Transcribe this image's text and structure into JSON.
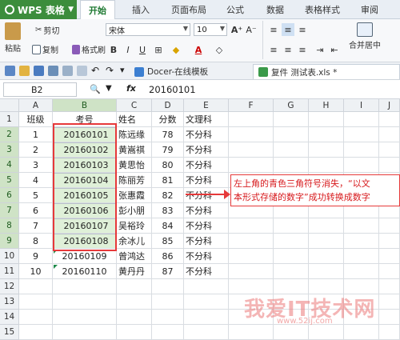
{
  "app": {
    "name": "WPS 表格"
  },
  "ribbon_tabs": [
    "开始",
    "插入",
    "页面布局",
    "公式",
    "数据",
    "表格样式",
    "审阅"
  ],
  "ribbon": {
    "paste": "粘贴",
    "cut": "剪切",
    "copy": "复制",
    "format_painter": "格式刷",
    "font": "宋体",
    "font_size": "10",
    "merge_center": "合并居中"
  },
  "doc_tabs": [
    {
      "label": "Docer-在线模板",
      "icon": "docer-icon"
    },
    {
      "label": "复件 测试表.xls *",
      "icon": "spreadsheet-icon"
    }
  ],
  "formula_bar": {
    "cell_ref": "B2",
    "fx": "fx",
    "value": "20160101"
  },
  "columns": [
    "A",
    "B",
    "C",
    "D",
    "E",
    "F",
    "G",
    "H",
    "I",
    "J"
  ],
  "rows": [
    "1",
    "2",
    "3",
    "4",
    "5",
    "6",
    "7",
    "8",
    "9",
    "10",
    "11",
    "12",
    "13",
    "14",
    "15"
  ],
  "table": {
    "headers": [
      "班级",
      "考号",
      "姓名",
      "分数",
      "文理科"
    ],
    "rows": [
      [
        "1",
        "20160101",
        "陈远缘",
        "78",
        "不分科"
      ],
      [
        "2",
        "20160102",
        "黄嵩祺",
        "79",
        "不分科"
      ],
      [
        "3",
        "20160103",
        "黄思怡",
        "80",
        "不分科"
      ],
      [
        "4",
        "20160104",
        "陈丽芳",
        "81",
        "不分科"
      ],
      [
        "5",
        "20160105",
        "张惠霞",
        "82",
        "不分科"
      ],
      [
        "6",
        "20160106",
        "彭小朋",
        "83",
        "不分科"
      ],
      [
        "7",
        "20160107",
        "吴裕玲",
        "84",
        "不分科"
      ],
      [
        "8",
        "20160108",
        "余冰儿",
        "85",
        "不分科"
      ],
      [
        "9",
        "20160109",
        "曾鸿达",
        "86",
        "不分科"
      ],
      [
        "10",
        "20160110",
        "黄丹丹",
        "87",
        "不分科"
      ]
    ]
  },
  "annotation": {
    "line1": "左上角的青色三角符号消失，“以文",
    "line2": "本形式存储的数字”成功转换成数字"
  },
  "watermark": {
    "text": "我爱IT技术网",
    "sub": "www.52ij.com"
  },
  "colors": {
    "accent": "#3c8d3c",
    "selection": "#dff0d8",
    "annotation": "#e6393a"
  }
}
